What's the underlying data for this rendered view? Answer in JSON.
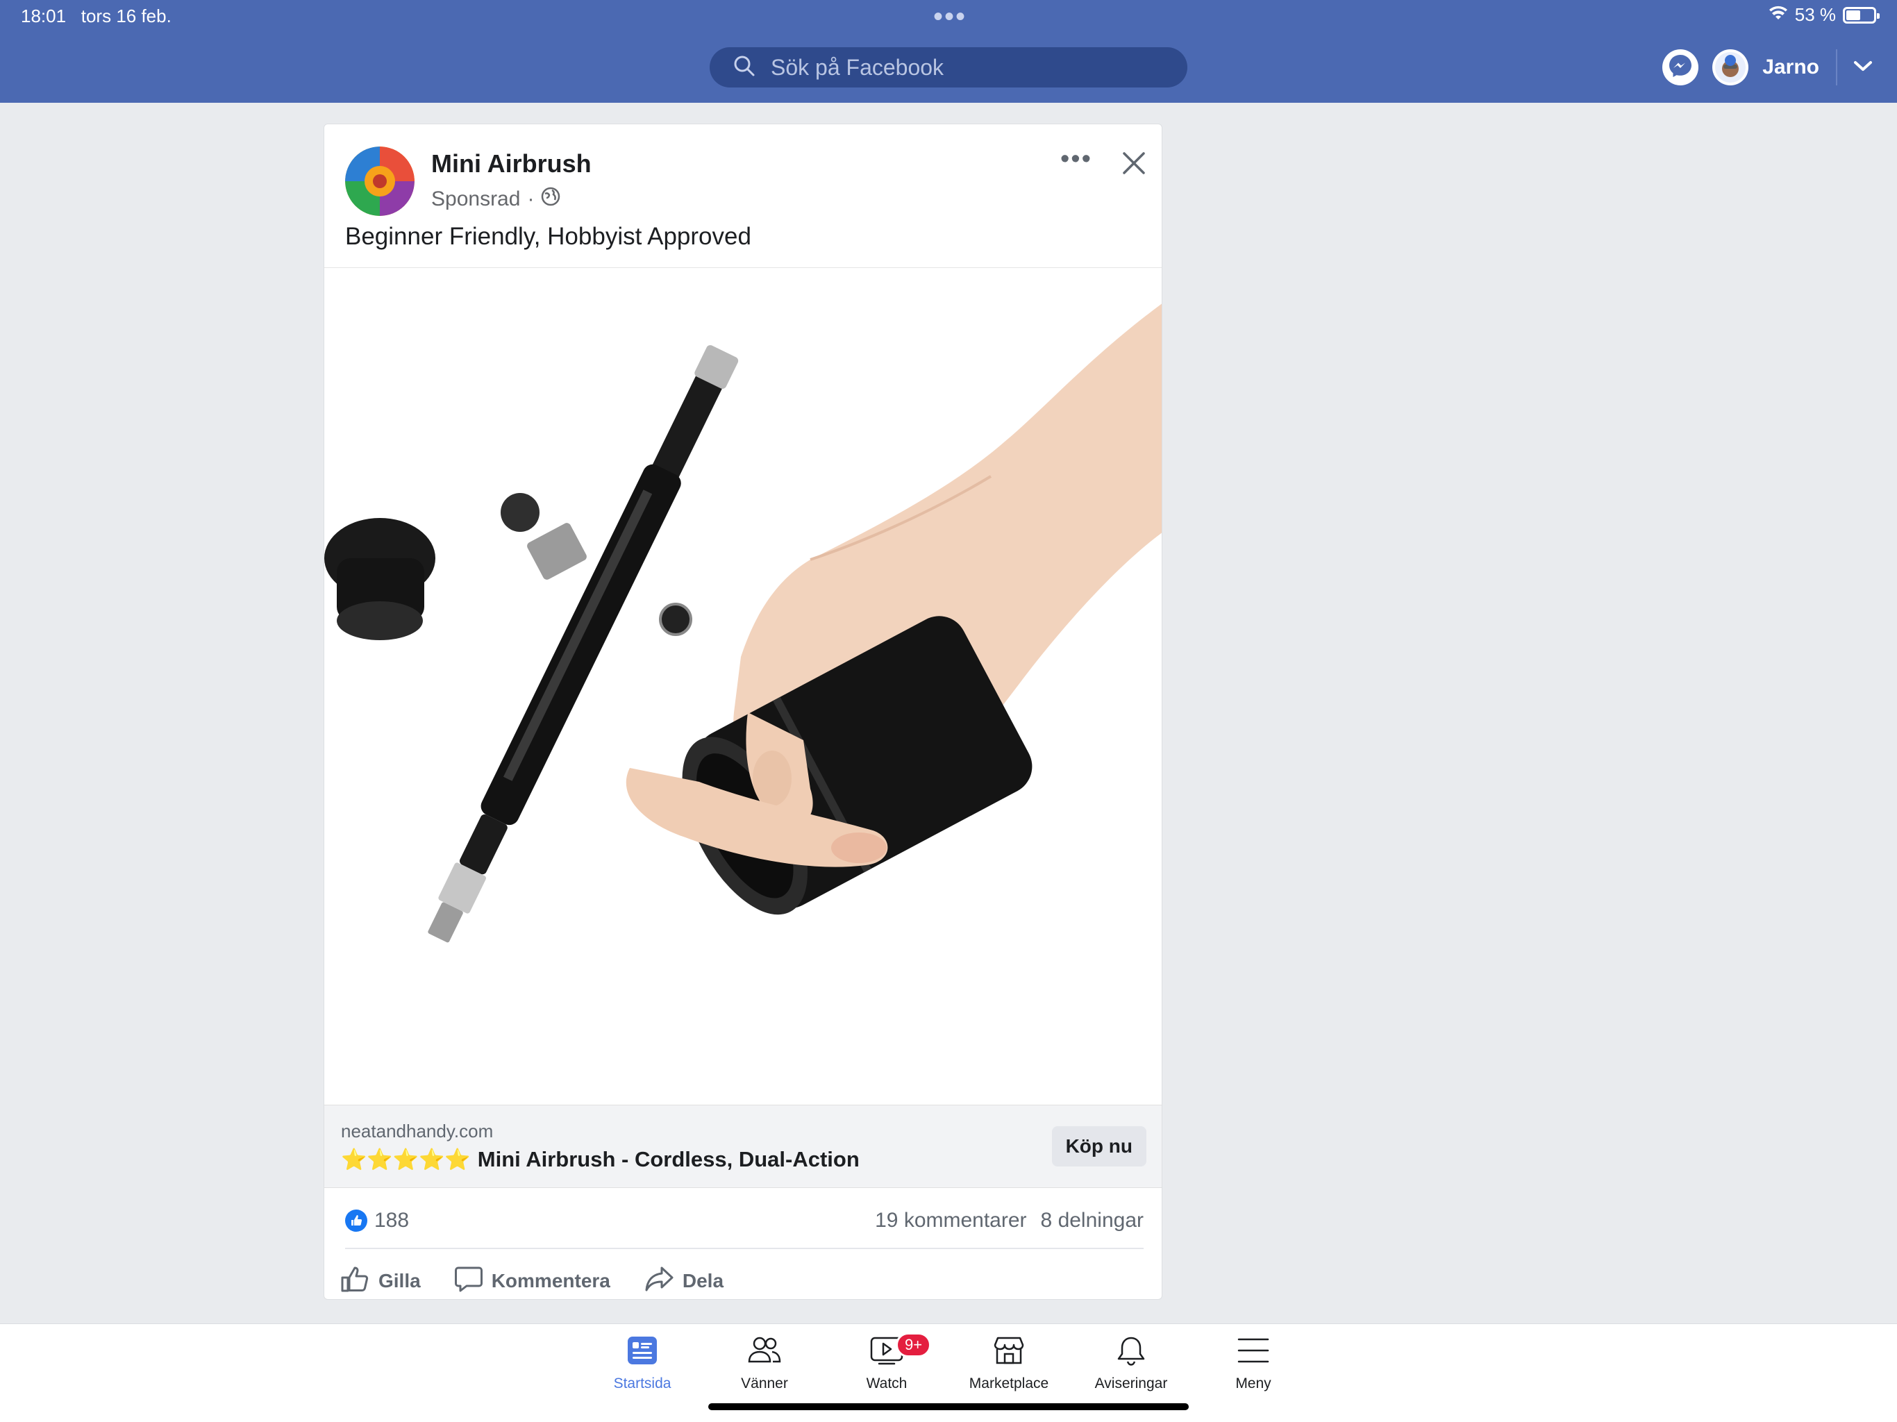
{
  "status_bar": {
    "time": "18:01",
    "date": "tors 16 feb.",
    "battery": "53 %",
    "battery_level": 0.53,
    "dots": "•••"
  },
  "header": {
    "search_placeholder": "Sök på Facebook",
    "user_name": "Jarno"
  },
  "post": {
    "page_name": "Mini Airbrush",
    "sponsored": "Sponsrad",
    "separator": "·",
    "caption": "Beginner Friendly, Hobbyist Approved",
    "link": {
      "domain": "neatandhandy.com",
      "stars": "⭐⭐⭐⭐⭐",
      "title": "Mini Airbrush - Cordless, Dual-Action",
      "cta": "Köp nu"
    },
    "stats": {
      "likes": "188",
      "comments": "19 kommentarer",
      "shares": "8 delningar"
    },
    "actions": {
      "like": "Gilla",
      "comment": "Kommentera",
      "share": "Dela"
    }
  },
  "bottom_nav": {
    "items": [
      {
        "label": "Startsida"
      },
      {
        "label": "Vänner"
      },
      {
        "label": "Watch",
        "badge": "9+"
      },
      {
        "label": "Marketplace"
      },
      {
        "label": "Aviseringar"
      },
      {
        "label": "Meny"
      }
    ]
  },
  "colors": {
    "brand": "#4b69b2",
    "active_tab": "#4b78e0",
    "badge": "#e41e3f",
    "like": "#1877f2"
  }
}
